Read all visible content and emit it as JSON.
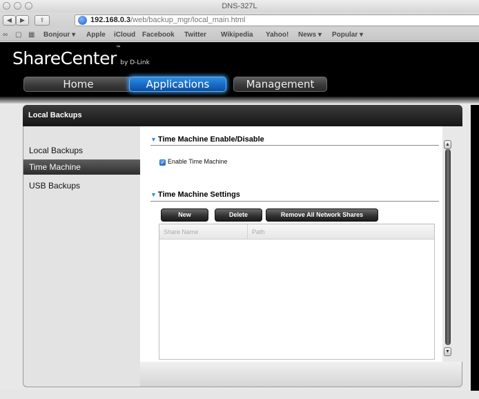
{
  "browser": {
    "window_title": "DNS-327L",
    "url_host": "192.168.0.3",
    "url_path": "/web/backup_mgr/local_main.html",
    "bookmarks": [
      {
        "label": "Bonjour ▾"
      },
      {
        "label": "Apple"
      },
      {
        "label": "iCloud"
      },
      {
        "label": "Facebook"
      },
      {
        "label": "Twitter"
      },
      {
        "label": "Wikipedia"
      },
      {
        "label": "Yahoo!"
      },
      {
        "label": "News ▾"
      },
      {
        "label": "Popular ▾"
      }
    ]
  },
  "app": {
    "logo_main": "ShareCenter",
    "logo_tm": "™",
    "logo_by": "by D-Link",
    "nav": {
      "home": "Home",
      "applications": "Applications",
      "management": "Management"
    },
    "active_nav": "applications"
  },
  "panel": {
    "title": "Local Backups",
    "sidebar": [
      {
        "label": "Local Backups",
        "selected": false
      },
      {
        "label": "Time Machine",
        "selected": true
      },
      {
        "label": "USB Backups",
        "selected": false
      }
    ]
  },
  "content": {
    "enable_section": "Time Machine Enable/Disable",
    "enable_checkbox": {
      "label": "Enable Time Machine",
      "checked": true
    },
    "settings_section": "Time Machine Settings",
    "buttons": {
      "new": "New",
      "delete": "Delete",
      "remove_all": "Remove All Network Shares"
    },
    "table": {
      "columns": [
        "Share Name",
        "Path"
      ],
      "rows": []
    }
  },
  "colors": {
    "accent": "#1a6fd0",
    "header_bg": "#000000",
    "triangle": "#2b8fe0"
  }
}
